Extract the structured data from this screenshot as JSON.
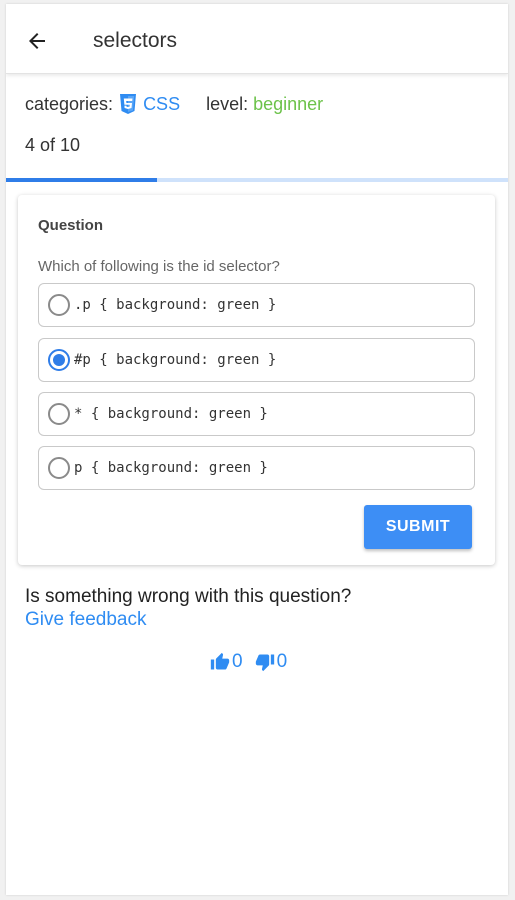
{
  "header": {
    "back_icon": "arrow-left-icon",
    "title": "selectors"
  },
  "meta": {
    "categories_label": "categories:",
    "category_icon": "css3-icon",
    "category": "CSS",
    "level_label": "level:",
    "level": "beginner"
  },
  "progress": {
    "text": "4 of 10",
    "current": 4,
    "total": 10,
    "fraction": 0.3
  },
  "question": {
    "heading": "Question",
    "text": "Which of following is the id selector?",
    "options": [
      {
        "label": ".p { background: green }",
        "selected": false
      },
      {
        "label": "#p { background: green }",
        "selected": true
      },
      {
        "label": "* { background: green }",
        "selected": false
      },
      {
        "label": "p { background: green }",
        "selected": false
      }
    ],
    "submit_label": "SUBMIT"
  },
  "feedback": {
    "prompt": "Is something wrong with this question?",
    "link": "Give feedback",
    "thumbs_up_icon": "thumbs-up-icon",
    "thumbs_up_count": "0",
    "thumbs_down_icon": "thumbs-down-icon",
    "thumbs_down_count": "0"
  },
  "colors": {
    "accent": "#2f7de8",
    "link": "#2f8cf2",
    "level": "#6cc24a",
    "button": "#3d8ef5"
  }
}
